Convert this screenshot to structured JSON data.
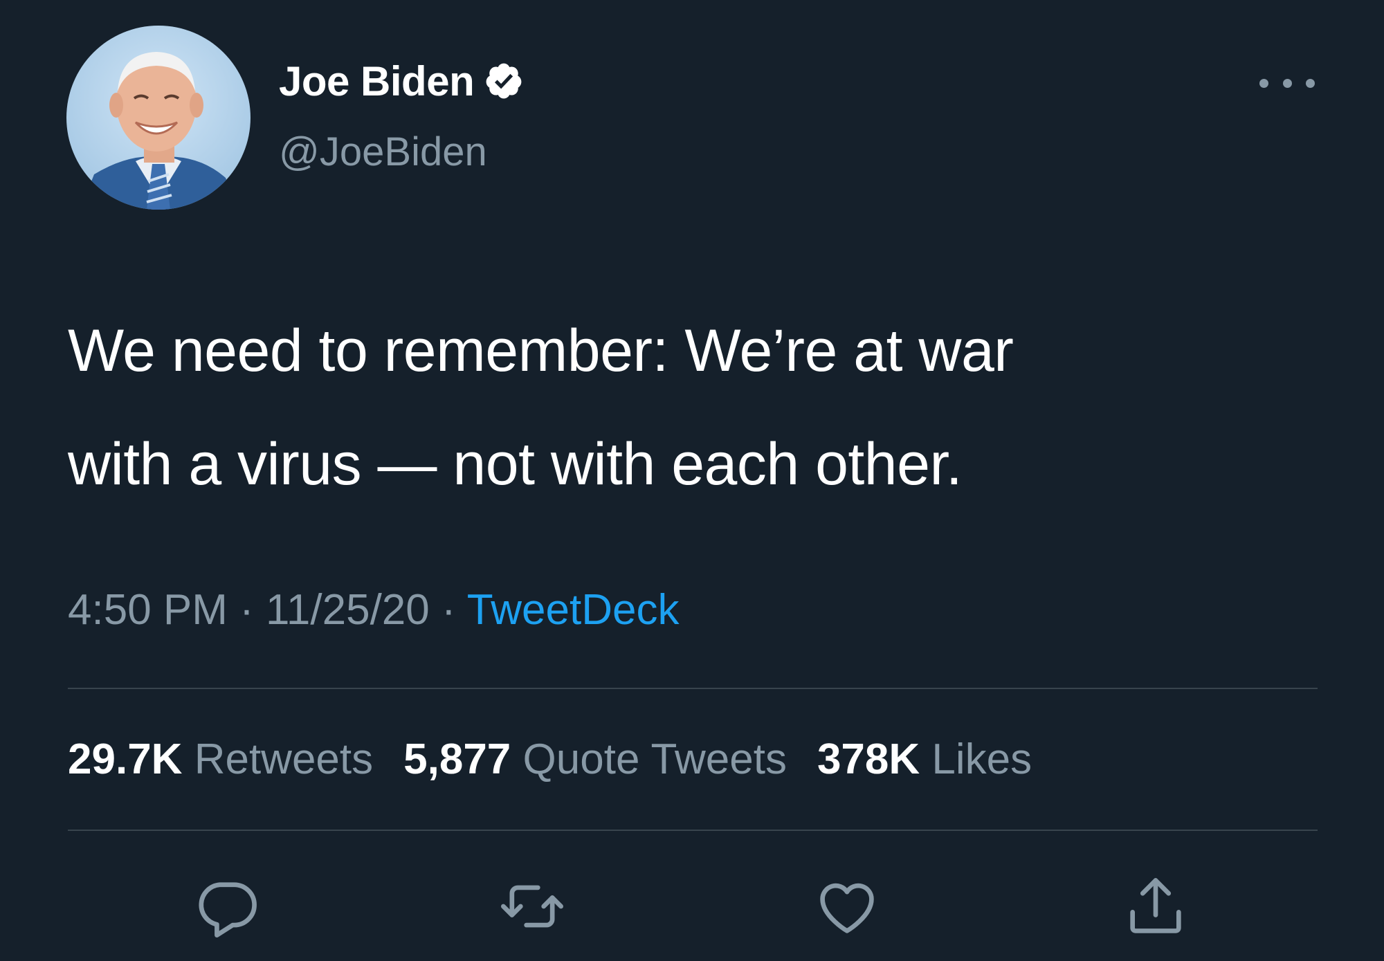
{
  "author": {
    "display_name": "Joe Biden",
    "handle": "@JoeBiden",
    "verified": true
  },
  "tweet": {
    "text_lines": [
      "We need to remember: We’re at war",
      "with a virus — not with each other."
    ],
    "time": "4:50 PM",
    "date": "11/25/20",
    "separator": "·",
    "source": "TweetDeck"
  },
  "stats": {
    "retweets_count": "29.7K",
    "retweets_label": "Retweets",
    "quotes_count": "5,877",
    "quotes_label": "Quote Tweets",
    "likes_count": "378K",
    "likes_label": "Likes"
  },
  "actions": [
    "reply-icon",
    "retweet-icon",
    "like-icon",
    "share-icon"
  ],
  "colors": {
    "background": "#15202b",
    "primary_text": "#ffffff",
    "secondary_text": "#8899a6",
    "accent": "#1da1f2",
    "divider": "#38444d"
  }
}
